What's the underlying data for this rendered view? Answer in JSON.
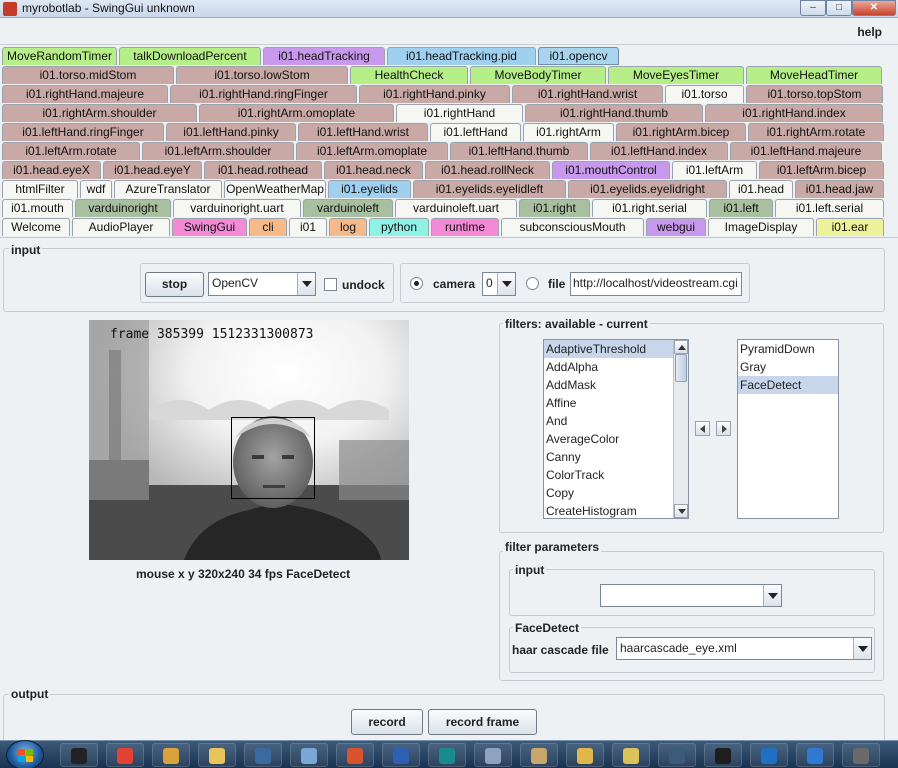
{
  "window": {
    "title": "myrobotlab - SwingGui unknown",
    "minimize": "–",
    "maximize": "□",
    "close": "✕"
  },
  "menu": {
    "help": "help"
  },
  "colors": {
    "green": "#b6ef87",
    "rose": "#c9a9a5",
    "white": "#f6f7f3",
    "purple": "#c898ec",
    "blue": "#9fd0f0",
    "sage": "#a8bfa0",
    "pink": "#f48ad6",
    "orange": "#f6b98a",
    "yellow": "#eef29a",
    "cyan": "#8ff2e6",
    "teal": "#96d8c6"
  },
  "tabs": [
    [
      {
        "label": "MoveRandomTimer",
        "color": "green"
      },
      {
        "label": "talkDownloadPercent",
        "color": "green"
      },
      {
        "label": "i01.headTracking",
        "color": "purple"
      },
      {
        "label": "i01.headTracking.pid",
        "color": "blue"
      },
      {
        "label": "i01.opencv",
        "color": "blue",
        "selected": true
      }
    ],
    [
      {
        "label": "i01.torso.midStom",
        "color": "rose"
      },
      {
        "label": "i01.torso.lowStom",
        "color": "rose"
      },
      {
        "label": "HealthCheck",
        "color": "green"
      },
      {
        "label": "MoveBodyTimer",
        "color": "green"
      },
      {
        "label": "MoveEyesTimer",
        "color": "green"
      },
      {
        "label": "MoveHeadTimer",
        "color": "green"
      }
    ],
    [
      {
        "label": "i01.rightHand.majeure",
        "color": "rose"
      },
      {
        "label": "i01.rightHand.ringFinger",
        "color": "rose"
      },
      {
        "label": "i01.rightHand.pinky",
        "color": "rose"
      },
      {
        "label": "i01.rightHand.wrist",
        "color": "rose"
      },
      {
        "label": "i01.torso",
        "color": "white"
      },
      {
        "label": "i01.torso.topStom",
        "color": "rose"
      }
    ],
    [
      {
        "label": "i01.rightArm.shoulder",
        "color": "rose"
      },
      {
        "label": "i01.rightArm.omoplate",
        "color": "rose"
      },
      {
        "label": "i01.rightHand",
        "color": "white"
      },
      {
        "label": "i01.rightHand.thumb",
        "color": "rose"
      },
      {
        "label": "i01.rightHand.index",
        "color": "rose"
      }
    ],
    [
      {
        "label": "i01.leftHand.ringFinger",
        "color": "rose"
      },
      {
        "label": "i01.leftHand.pinky",
        "color": "rose"
      },
      {
        "label": "i01.leftHand.wrist",
        "color": "rose"
      },
      {
        "label": "i01.leftHand",
        "color": "white"
      },
      {
        "label": "i01.rightArm",
        "color": "white"
      },
      {
        "label": "i01.rightArm.bicep",
        "color": "rose"
      },
      {
        "label": "i01.rightArm.rotate",
        "color": "rose"
      }
    ],
    [
      {
        "label": "i01.leftArm.rotate",
        "color": "rose"
      },
      {
        "label": "i01.leftArm.shoulder",
        "color": "rose"
      },
      {
        "label": "i01.leftArm.omoplate",
        "color": "rose"
      },
      {
        "label": "i01.leftHand.thumb",
        "color": "rose"
      },
      {
        "label": "i01.leftHand.index",
        "color": "rose"
      },
      {
        "label": "i01.leftHand.majeure",
        "color": "rose"
      }
    ],
    [
      {
        "label": "i01.head.eyeX",
        "color": "rose"
      },
      {
        "label": "i01.head.eyeY",
        "color": "rose"
      },
      {
        "label": "i01.head.rothead",
        "color": "rose"
      },
      {
        "label": "i01.head.neck",
        "color": "rose"
      },
      {
        "label": "i01.head.rollNeck",
        "color": "rose"
      },
      {
        "label": "i01.mouthControl",
        "color": "purple"
      },
      {
        "label": "i01.leftArm",
        "color": "white"
      },
      {
        "label": "i01.leftArm.bicep",
        "color": "rose"
      }
    ],
    [
      {
        "label": "htmlFilter",
        "color": "white"
      },
      {
        "label": "wdf",
        "color": "white"
      },
      {
        "label": "AzureTranslator",
        "color": "white"
      },
      {
        "label": "OpenWeatherMap",
        "color": "white"
      },
      {
        "label": "i01.eyelids",
        "color": "blue"
      },
      {
        "label": "i01.eyelids.eyelidleft",
        "color": "rose"
      },
      {
        "label": "i01.eyelids.eyelidright",
        "color": "rose"
      },
      {
        "label": "i01.head",
        "color": "white"
      },
      {
        "label": "i01.head.jaw",
        "color": "rose"
      }
    ],
    [
      {
        "label": "i01.mouth",
        "color": "white"
      },
      {
        "label": "varduinoright",
        "color": "sage"
      },
      {
        "label": "varduinoright.uart",
        "color": "white"
      },
      {
        "label": "varduinoleft",
        "color": "sage"
      },
      {
        "label": "varduinoleft.uart",
        "color": "white"
      },
      {
        "label": "i01.right",
        "color": "sage"
      },
      {
        "label": "i01.right.serial",
        "color": "white"
      },
      {
        "label": "i01.left",
        "color": "sage"
      },
      {
        "label": "i01.left.serial",
        "color": "white"
      }
    ],
    [
      {
        "label": "Welcome",
        "color": "white"
      },
      {
        "label": "AudioPlayer",
        "color": "white"
      },
      {
        "label": "SwingGui",
        "color": "pink"
      },
      {
        "label": "cli",
        "color": "orange"
      },
      {
        "label": "i01",
        "color": "white"
      },
      {
        "label": "log",
        "color": "orange"
      },
      {
        "label": "python",
        "color": "cyan"
      },
      {
        "label": "runtime",
        "color": "pink"
      },
      {
        "label": "subconsciousMouth",
        "color": "white"
      },
      {
        "label": "webgui",
        "color": "purple"
      },
      {
        "label": "ImageDisplay",
        "color": "white"
      },
      {
        "label": "i01.ear",
        "color": "yellow"
      }
    ]
  ],
  "input_panel": {
    "title": "input",
    "stop_label": "stop",
    "grabber": "OpenCV",
    "undock_label": "undock",
    "camera_label": "camera",
    "camera_index": "0",
    "file_label": "file",
    "file_url": "http://localhost/videostream.cgi"
  },
  "video": {
    "overlay_text": "frame 385399 1512331300873",
    "status": "mouse x y  320x240  34 fps  FaceDetect"
  },
  "filters": {
    "title": "filters: available - current",
    "available": [
      "AdaptiveThreshold",
      "AddAlpha",
      "AddMask",
      "Affine",
      "And",
      "AverageColor",
      "Canny",
      "ColorTrack",
      "Copy",
      "CreateHistogram"
    ],
    "available_selected": "AdaptiveThreshold",
    "current": [
      "PyramidDown",
      "Gray",
      "FaceDetect"
    ],
    "current_selected": "FaceDetect"
  },
  "filter_parameters": {
    "title": "filter parameters",
    "input_title": "input",
    "input_value": "",
    "section_title": "FaceDetect",
    "cascade_label": "haar cascade file",
    "cascade_value": "haarcascade_eye.xml"
  },
  "output_panel": {
    "title": "output",
    "record_label": "record",
    "record_frame_label": "record frame"
  },
  "taskbar": {
    "items": [
      "cmd",
      "chrome",
      "tools",
      "explorer",
      "window",
      "paint",
      "recorder",
      "binoculars",
      "arduino",
      "settings",
      "app",
      "paint2",
      "folder",
      "monitor",
      "sublime",
      "outlook",
      "ie",
      "misc"
    ]
  }
}
